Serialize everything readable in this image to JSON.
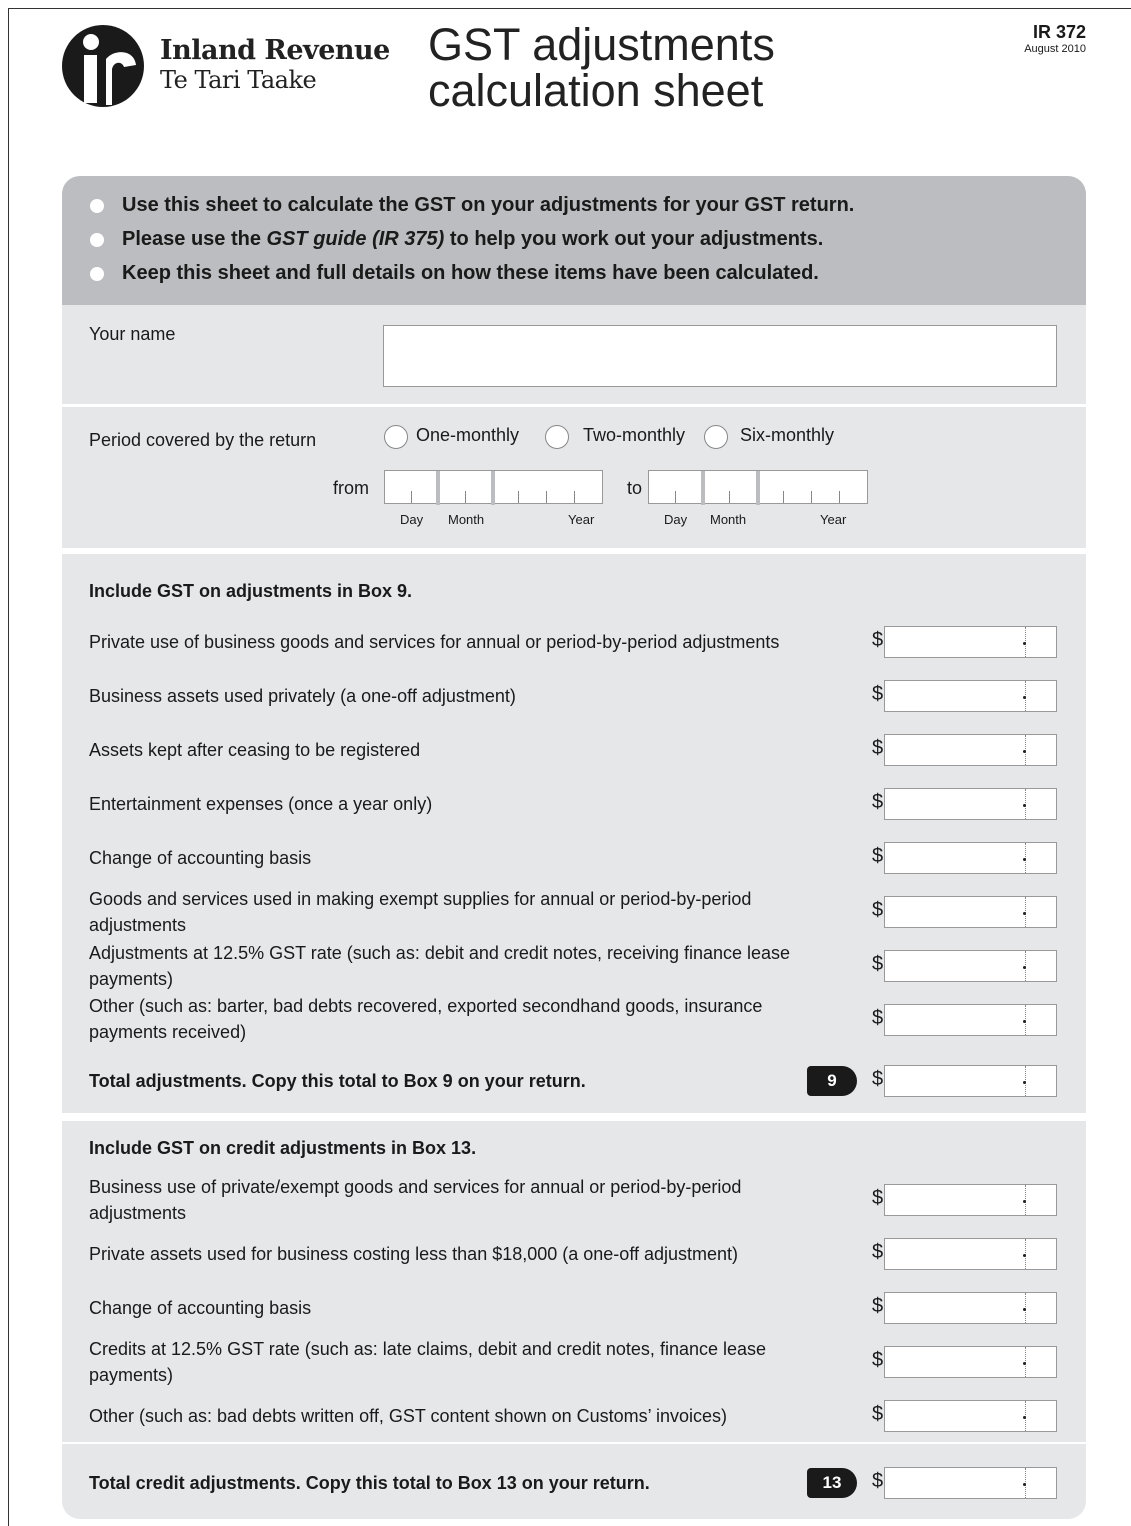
{
  "header": {
    "org_name": "Inland Revenue",
    "org_sub": "Te Tari Taake",
    "title_line1": "GST adjustments",
    "title_line2": "calculation sheet",
    "form_code": "IR 372",
    "form_date": "August 2010"
  },
  "intro": {
    "bullet1": "Use this sheet to calculate the GST on your adjustments for your GST return.",
    "bullet2_pre": "Please use the ",
    "bullet2_em": "GST guide (IR 375)",
    "bullet2_post": " to help you work out your adjustments.",
    "bullet3": "Keep this sheet and full details on how these items have been calculated."
  },
  "name_section": {
    "label": "Your name",
    "value": ""
  },
  "period": {
    "label": "Period covered by the return",
    "options": [
      "One-monthly",
      "Two-monthly",
      "Six-monthly"
    ],
    "from_label": "from",
    "to_label": "to",
    "day": "Day",
    "month": "Month",
    "year": "Year"
  },
  "section9": {
    "heading": "Include GST on adjustments in Box 9.",
    "items": [
      "Private use of business goods and services for annual or period-by-period adjustments",
      "Business assets used privately (a one-off adjustment)",
      "Assets kept after ceasing to be registered",
      "Entertainment expenses (once a year only)",
      "Change of accounting basis",
      "Goods and services used in making exempt supplies for annual or period-by-period adjustments",
      "Adjustments at 12.5% GST rate (such as: debit and credit notes, receiving finance lease payments)",
      "Other (such as: barter, bad debts recovered, exported secondhand goods, insurance payments received)"
    ],
    "total_label": "Total adjustments.  Copy this total to Box 9 on your return.",
    "box": "9"
  },
  "section13": {
    "heading": "Include GST on credit adjustments in Box 13.",
    "items": [
      "Business use of private/exempt goods and services for annual or period-by-period adjustments",
      "Private assets used for business costing less than $18,000 (a one-off adjustment)",
      "Change of accounting basis",
      "Credits at 12.5% GST rate (such as: late claims, debit and credit notes, finance lease payments)",
      "Other (such as: bad debts written off, GST content shown on Customs’ invoices)"
    ],
    "total_label": "Total credit adjustments.  Copy this total to Box 13 on your return.",
    "box": "13"
  },
  "currency_symbol": "$"
}
